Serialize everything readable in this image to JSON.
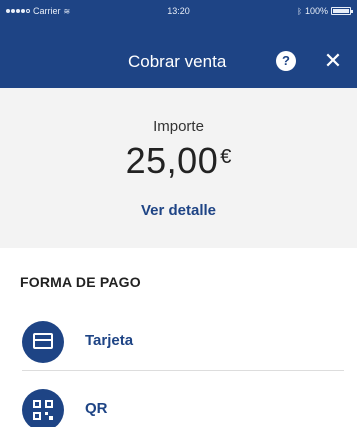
{
  "status_bar": {
    "carrier": "Carrier",
    "time": "13:20",
    "battery": "100%"
  },
  "header": {
    "title": "Cobrar venta",
    "help_label": "?",
    "close_label": "✕"
  },
  "amount": {
    "label": "Importe",
    "value": "25,00",
    "currency": "€",
    "detail_link": "Ver detalle"
  },
  "payment": {
    "section_title": "FORMA DE PAGO",
    "methods": [
      {
        "label": "Tarjeta",
        "icon": "credit-card-icon"
      },
      {
        "label": "QR",
        "icon": "qr-code-icon"
      }
    ]
  },
  "colors": {
    "primary": "#1e4485",
    "panel_bg": "#f3f3f3"
  }
}
